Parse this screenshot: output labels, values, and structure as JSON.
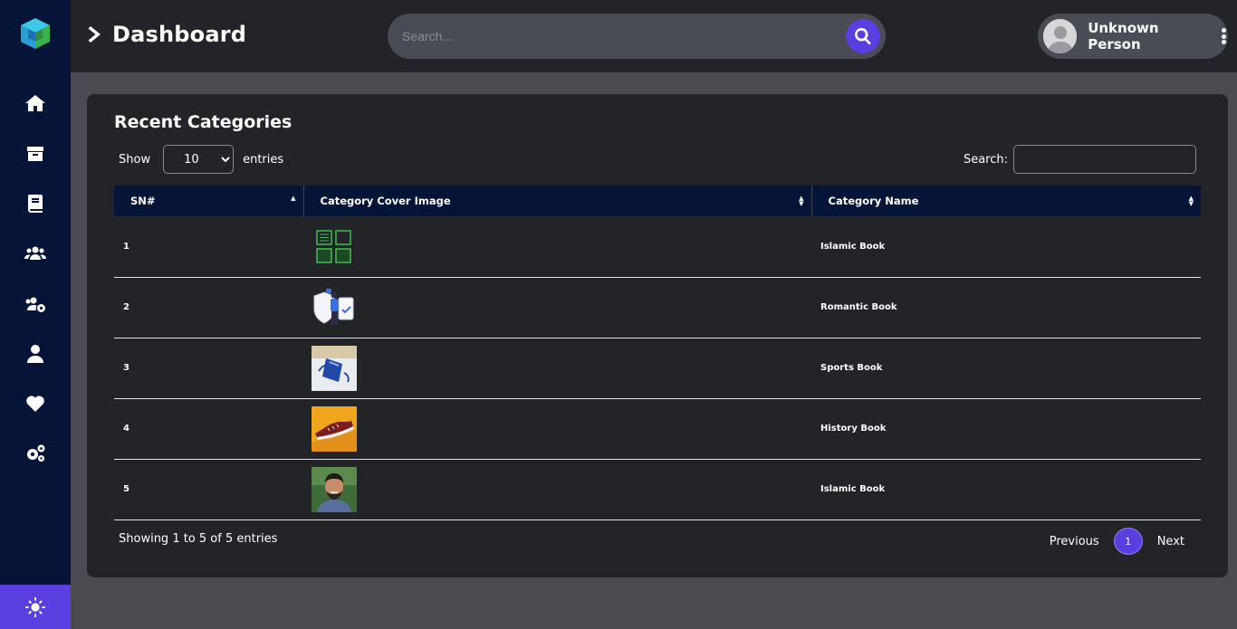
{
  "header": {
    "title": "Dashboard",
    "search_placeholder": "Search...",
    "user_name": "Unknown Person"
  },
  "sidebar": {
    "items": [
      {
        "icon": "home-icon"
      },
      {
        "icon": "box-icon"
      },
      {
        "icon": "book-icon"
      },
      {
        "icon": "users-icon"
      },
      {
        "icon": "users-cog-icon"
      },
      {
        "icon": "user-icon"
      },
      {
        "icon": "heart-icon"
      },
      {
        "icon": "cogs-icon"
      }
    ],
    "footer_icon": "sun-icon"
  },
  "card": {
    "title": "Recent Categories",
    "show_label": "Show",
    "entries_label": "entries",
    "page_length": "10",
    "search_label": "Search:"
  },
  "table": {
    "columns": [
      "SN#",
      "Category Cover Image",
      "Category Name"
    ],
    "rows": [
      {
        "sn": "1",
        "name": "Islamic Book"
      },
      {
        "sn": "2",
        "name": "Romantic Book"
      },
      {
        "sn": "3",
        "name": "Sports Book"
      },
      {
        "sn": "4",
        "name": "History Book"
      },
      {
        "sn": "5",
        "name": "Islamic Book"
      }
    ]
  },
  "footer": {
    "info": "Showing 1 to 5 of 5 entries",
    "previous": "Previous",
    "page": "1",
    "next": "Next"
  },
  "colors": {
    "accent": "#5b3ee0",
    "sidebar": "#061437",
    "panel": "#222428",
    "background": "#4a4c52"
  }
}
